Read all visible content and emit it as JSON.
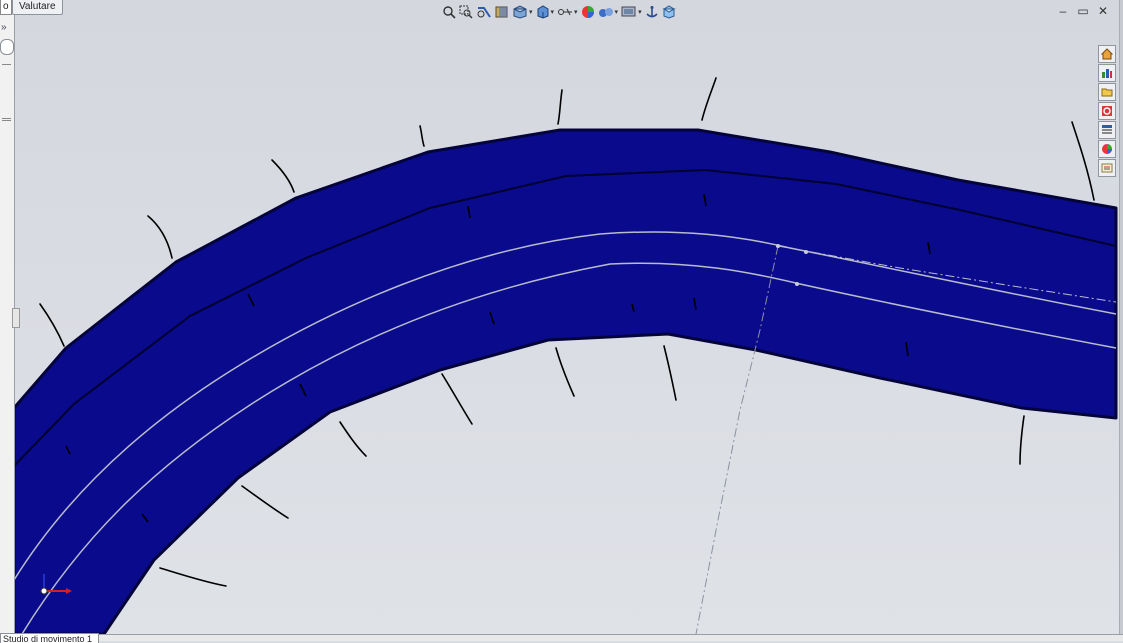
{
  "window": {
    "tab_left_fragment": "o",
    "tab_label": "Valutare",
    "minimize_glyph": "–",
    "restore_glyph": "▭",
    "close_glyph": "✕"
  },
  "left_strip": {
    "expand_glyph": "»"
  },
  "hud_toolbar": {
    "buttons": [
      {
        "name": "zoom-to-fit-icon",
        "has_menu": false
      },
      {
        "name": "zoom-to-area-icon",
        "has_menu": false
      },
      {
        "name": "previous-view-icon",
        "has_menu": false
      },
      {
        "name": "section-view-icon",
        "has_menu": false
      },
      {
        "name": "view-orientation-icon",
        "has_menu": true
      },
      {
        "name": "display-style-icon",
        "has_menu": true
      },
      {
        "name": "hide-show-items-icon",
        "has_menu": true
      },
      {
        "name": "edit-appearance-icon",
        "has_menu": true
      },
      {
        "name": "apply-scene-icon",
        "has_menu": true
      },
      {
        "name": "view-settings-icon",
        "has_menu": true
      },
      {
        "name": "display-pane-icon",
        "has_menu": false
      }
    ]
  },
  "task_pane": {
    "buttons": [
      "solidworks-resources-icon",
      "design-library-icon",
      "file-explorer-icon",
      "search-icon",
      "view-palette-icon",
      "appearances-scenes-icon",
      "custom-properties-icon"
    ]
  },
  "bottom_tab": {
    "label": "Studio di movimento 1"
  },
  "colors": {
    "viewport_bg": "#d7dae0",
    "part_fill": "#0a0a8c",
    "part_edge": "#04043a",
    "guide_line": "#b8bccc"
  }
}
